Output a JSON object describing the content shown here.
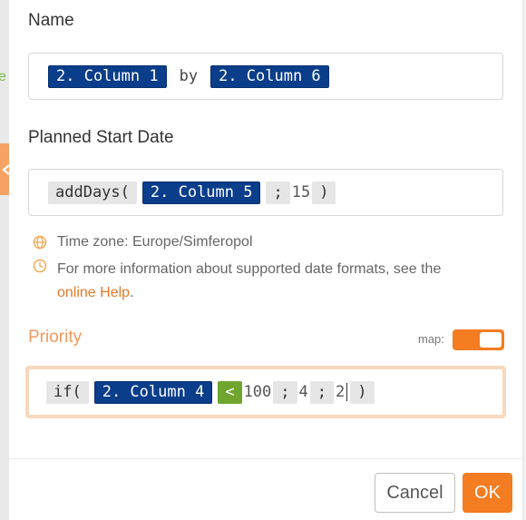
{
  "colors": {
    "accent": "#f47c21",
    "variable_pill": "#0a3d8a",
    "operator_pill": "#6fa52f"
  },
  "name_field": {
    "label": "Name",
    "var1": "2. Column 1",
    "separator": "by",
    "var2": "2. Column 6"
  },
  "start_date_field": {
    "label": "Planned Start Date",
    "fn": "addDays(",
    "var": "2. Column 5",
    "sep": ";",
    "value": "15",
    "close": ")",
    "timezone_note": "Time zone: Europe/Simferopol",
    "help_text": "For more information about supported date formats, see the",
    "help_link": "online Help",
    "help_end": "."
  },
  "priority_field": {
    "label": "Priority",
    "map_label": "map:",
    "map_enabled": true,
    "fn": "if(",
    "var": "2. Column 4",
    "op": "<",
    "value1": "100",
    "sep1": ";",
    "value2": "4",
    "sep2": ";",
    "value3": "2",
    "close": ")"
  },
  "buttons": {
    "cancel": "Cancel",
    "ok": "OK"
  },
  "icons": {
    "timezone": "globe-icon",
    "help": "clock-icon",
    "collapse": "chevron-left-icon"
  }
}
